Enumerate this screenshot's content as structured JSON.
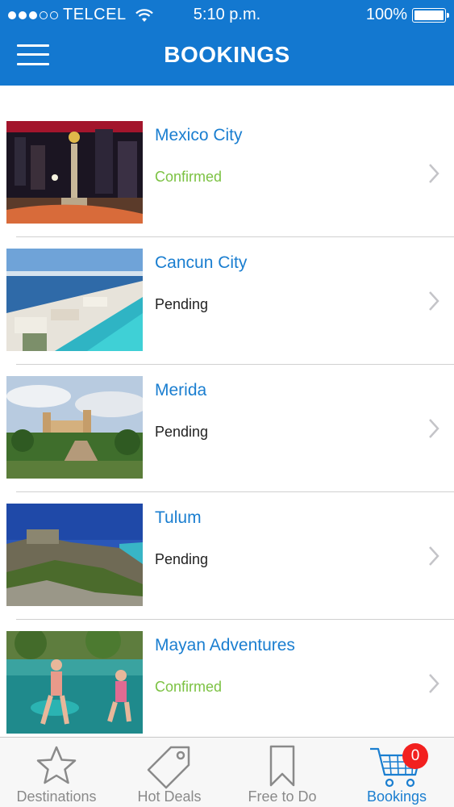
{
  "status_bar": {
    "carrier": "TELCEL",
    "time": "5:10 p.m.",
    "battery": "100%",
    "signal_dots_full": 3,
    "signal_dots_total": 5
  },
  "nav": {
    "title": "BOOKINGS",
    "menu_icon": "hamburger-menu-icon"
  },
  "colors": {
    "brand": "#1378d0",
    "link": "#1a7ed0",
    "confirmed": "#7cc243",
    "pending": "#222222",
    "badge": "#f2201f"
  },
  "bookings": [
    {
      "title": "Mexico City",
      "status": "Confirmed",
      "status_type": "confirmed"
    },
    {
      "title": "Cancun City",
      "status": "Pending",
      "status_type": "pending"
    },
    {
      "title": "Merida",
      "status": "Pending",
      "status_type": "pending"
    },
    {
      "title": "Tulum",
      "status": "Pending",
      "status_type": "pending"
    },
    {
      "title": "Mayan Adventures",
      "status": "Confirmed",
      "status_type": "confirmed"
    }
  ],
  "tabs": [
    {
      "label": "Destinations",
      "icon": "star-icon",
      "active": false
    },
    {
      "label": "Hot Deals",
      "icon": "tag-icon",
      "active": false
    },
    {
      "label": "Free to Do",
      "icon": "bookmark-icon",
      "active": false
    },
    {
      "label": "Bookings",
      "icon": "cart-icon",
      "active": true,
      "badge": "0"
    }
  ]
}
